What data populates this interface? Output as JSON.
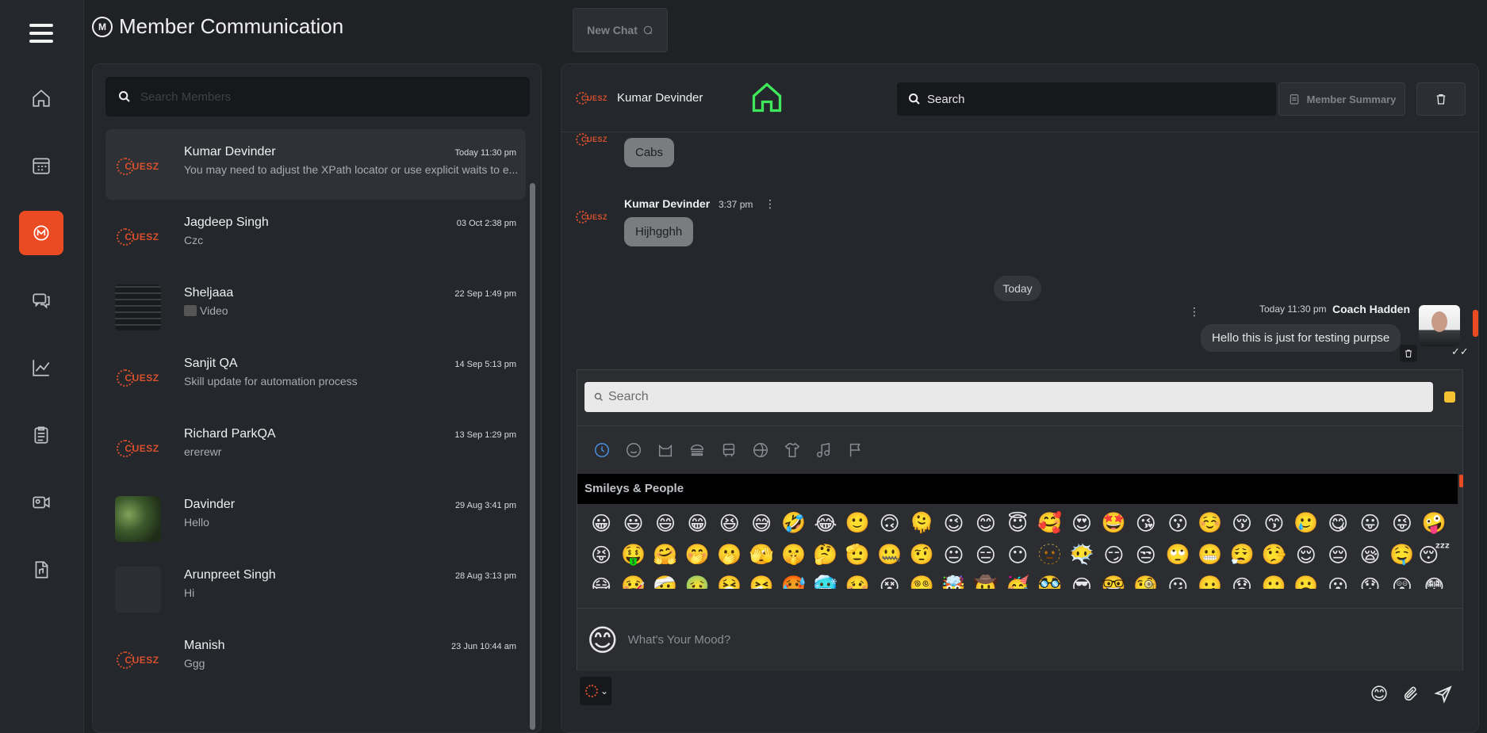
{
  "header": {
    "title": "Member Communication",
    "new_chat_label": "New Chat"
  },
  "rail": {
    "items": [
      "home-icon",
      "calendar-icon",
      "communication-icon",
      "chat-bubbles-icon",
      "chart-icon",
      "clipboard-icon",
      "video-id-icon",
      "document-icon"
    ]
  },
  "members": {
    "search_placeholder": "Search Members",
    "list": [
      {
        "name": "Kumar Devinder",
        "message": "You may need to adjust the XPath locator or use explicit waits to e...",
        "date": "Today 11:30 pm",
        "avatar": "cuesz"
      },
      {
        "name": "Jagdeep Singh",
        "message": "Czc",
        "date": "03 Oct 2:38 pm",
        "avatar": "cuesz"
      },
      {
        "name": "Sheljaaa",
        "message": "Video",
        "date": "22 Sep 1:49 pm",
        "avatar": "photo-dark"
      },
      {
        "name": "Sanjit QA",
        "message": "Skill update for automation process",
        "date": "14 Sep 5:13 pm",
        "avatar": "cuesz"
      },
      {
        "name": "Richard ParkQA",
        "message": "ererewr",
        "date": "13 Sep 1:29 pm",
        "avatar": "cuesz"
      },
      {
        "name": "Davinder",
        "message": "Hello",
        "date": "29 Aug 3:41 pm",
        "avatar": "photo-forest"
      },
      {
        "name": "Arunpreet Singh",
        "message": "Hi",
        "date": "28 Aug 3:13 pm",
        "avatar": "blank"
      },
      {
        "name": "Manish",
        "message": "Ggg",
        "date": "23 Jun 10:44 am",
        "avatar": "cuesz"
      }
    ]
  },
  "chat": {
    "contact_name": "Kumar Devinder",
    "search_label": "Search",
    "member_summary_label": "Member Summary",
    "messages": {
      "m1_text": "Cabs",
      "m2_sender": "Kumar Devinder",
      "m2_time": "3:37 pm",
      "m2_text": "Hijhgghh",
      "divider": "Today",
      "m3_time": "Today 11:30 pm",
      "m3_sender": "Coach Hadden",
      "m3_text": "Hello this is just for testing purpse"
    }
  },
  "emoji_picker": {
    "search_placeholder": "Search",
    "section_title": "Smileys & People",
    "mood_placeholder": "What's Your Mood?",
    "preview_emoji": "😊",
    "emojis": [
      "😀",
      "😃",
      "😄",
      "😁",
      "😆",
      "😅",
      "🤣",
      "😂",
      "🙂",
      "🙃",
      "🫠",
      "😉",
      "😊",
      "😇",
      "🥰",
      "😍",
      "🤩",
      "😘",
      "😗",
      "☺️",
      "😚",
      "😙",
      "🥲",
      "😋",
      "😛",
      "😜",
      "🤪",
      "😝",
      "🤑",
      "🤗",
      "🤭",
      "🫢",
      "🫣",
      "🤫",
      "🤔",
      "🫡",
      "🤐",
      "🤨",
      "😐",
      "😑",
      "😶",
      "🫥",
      "😶‍🌫️",
      "😏",
      "😒",
      "🙄",
      "😬",
      "😮‍💨",
      "🤥",
      "😌",
      "😔",
      "😪",
      "🤤",
      "😴",
      "😷",
      "🤒",
      "🤕",
      "🤢",
      "🤮",
      "🤧",
      "🥵",
      "🥶",
      "🥴",
      "😵",
      "😵‍💫",
      "🤯",
      "🤠",
      "🥳",
      "🥸",
      "😎",
      "🤓",
      "🧐",
      "😕",
      "🫤",
      "😟",
      "🙁",
      "☹️",
      "😮",
      "😯",
      "😲",
      "😳",
      "🥺",
      "🥹",
      "😦",
      "😧",
      "😨",
      "😰",
      "😥",
      "😢",
      "😭",
      "😱",
      "😖",
      "😣",
      "😞",
      "😓",
      "😩",
      "😫",
      "🥱",
      "😤",
      "😡",
      "😠",
      "🤬",
      "😈",
      "👿",
      "💀",
      "☠️",
      "💩",
      "🤡"
    ]
  }
}
